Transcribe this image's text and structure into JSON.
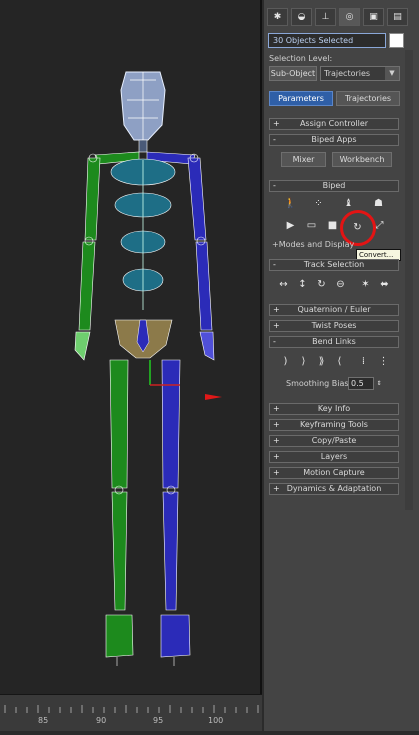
{
  "viewport": {
    "timeline_ticks": [
      "85",
      "90",
      "95",
      "100"
    ]
  },
  "command_panel": {
    "tab_icons": [
      "create-icon",
      "modify-icon",
      "hierarchy-icon",
      "motion-icon",
      "display-icon",
      "utilities-icon"
    ],
    "selection_name": "30 Objects Selected",
    "selection_level_label": "Selection Level:",
    "sub_object_button": "Sub-Object",
    "sub_object_dropdown": "Trajectories",
    "parameters_button": "Parameters",
    "trajectories_button": "Trajectories",
    "rollouts": {
      "assign_controller": "Assign Controller",
      "biped_apps": "Biped Apps",
      "biped": "Biped",
      "track_selection": "Track Selection",
      "quaternion_euler": "Quaternion / Euler",
      "twist_poses": "Twist Poses",
      "bend_links": "Bend Links",
      "key_info": "Key Info",
      "keyframing_tools": "Keyframing Tools",
      "copy_paste": "Copy/Paste",
      "layers": "Layers",
      "motion_capture": "Motion Capture",
      "dynamics_adaptation": "Dynamics & Adaptation"
    },
    "biped_apps": {
      "mixer": "Mixer",
      "workbench": "Workbench"
    },
    "biped_modes_label": "+Modes and Display",
    "tooltip": "Convert...",
    "smoothing_bias_label": "Smoothing Bias",
    "smoothing_bias_value": "0.5",
    "collapse_symbol": "-",
    "expand_symbol": "+"
  },
  "colors": {
    "highlight_circle": "#e31414",
    "left_limbs": "#1d8a1d",
    "right_limbs": "#2b2bb8",
    "spine": "#1e6e86",
    "head": "#8ea0c4",
    "pelvis": "#8c7a4a"
  }
}
